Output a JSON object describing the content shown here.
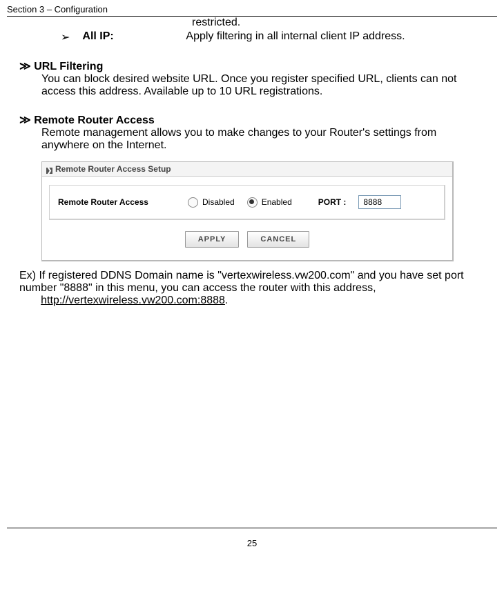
{
  "header": {
    "section_label": "Section 3 – Configuration"
  },
  "restricted_word": "restricted.",
  "all_ip": {
    "bullet": "➢",
    "label": "All IP:",
    "desc": "Apply filtering in all internal client IP address."
  },
  "url_filtering": {
    "marker": "≫",
    "title": "URL Filtering",
    "body": "You can block desired website URL. Once you register specified URL, clients can not access this address. Available up to 10 URL registrations."
  },
  "remote_access": {
    "marker": "≫",
    "title": "Remote Router Access",
    "body": "Remote management allows you to make changes to your Router's settings from anywhere on the Internet."
  },
  "panel": {
    "title_icon": "❯",
    "title": "Remote Router Access Setup",
    "row_label": "Remote Router Access",
    "opt_disabled": "Disabled",
    "opt_enabled": "Enabled",
    "port_label": "PORT :",
    "port_value": "8888",
    "btn_apply": "APPLY",
    "btn_cancel": "CANCEL"
  },
  "example": {
    "prefix": "Ex) If registered DDNS Domain name is \"vertexwireless.vw200.com\" and you have set port number \"8888\" in this menu, you can access the router with this address, ",
    "link": "http://vertexwireless.vw200.com:8888",
    "suffix": "."
  },
  "page_number": "25"
}
